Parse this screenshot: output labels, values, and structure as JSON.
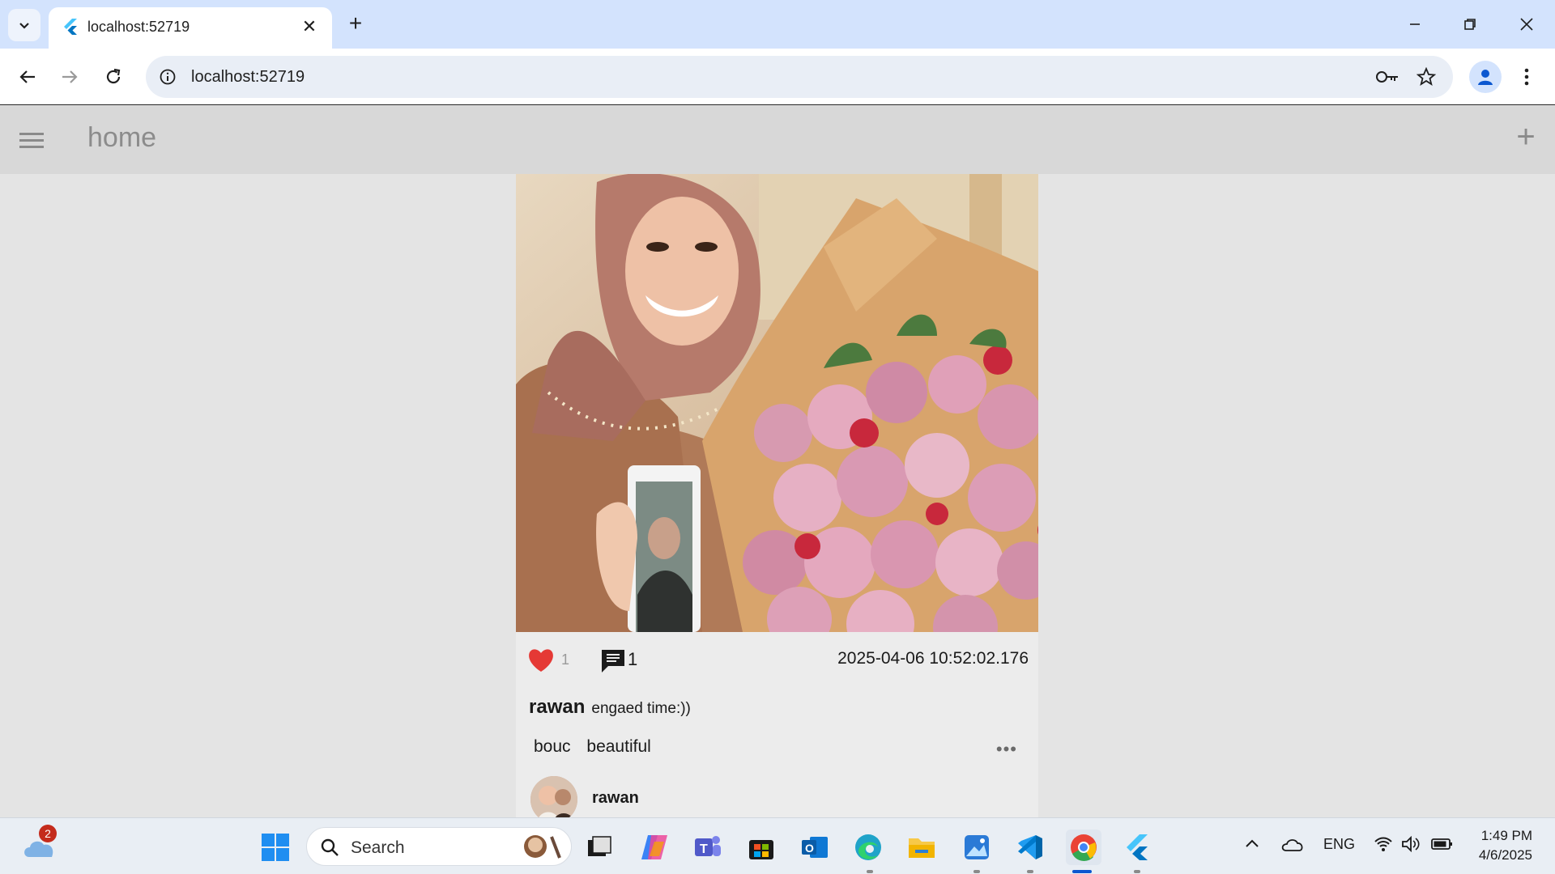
{
  "browser": {
    "tab_title": "localhost:52719",
    "url": "localhost:52719"
  },
  "app": {
    "title": "home"
  },
  "post": {
    "like_count": "1",
    "comment_count": "1",
    "timestamp": "2025-04-06 10:52:02.176",
    "author": "rawan",
    "caption": "engaed time:))",
    "tags": [
      "bouc",
      "beautiful"
    ],
    "comment_author": "rawan"
  },
  "taskbar": {
    "weather_badge": "2",
    "search_placeholder": "Search",
    "language": "ENG",
    "time": "1:49 PM",
    "date": "4/6/2025"
  },
  "colors": {
    "like": "#e53935",
    "chrome_tabstrip": "#d3e3fd",
    "appbar": "#d8d8d8"
  }
}
